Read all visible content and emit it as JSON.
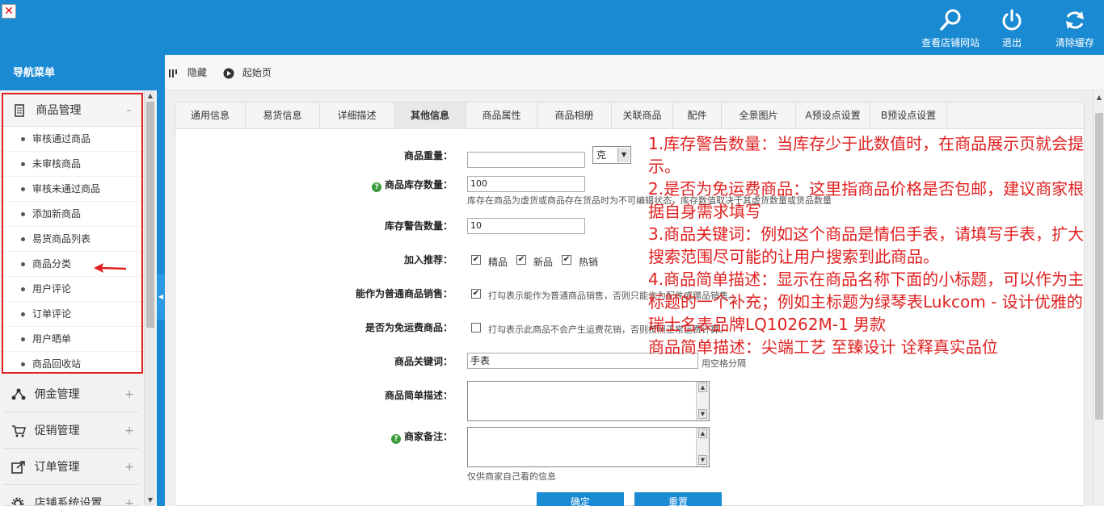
{
  "header": {
    "view_shop_label": "查看店铺网站",
    "logout_label": "退出",
    "clear_cache_label": "清除缓存"
  },
  "sidebar": {
    "title": "导航菜单",
    "active_group": {
      "label": "商品管理",
      "toggle": "–",
      "items": [
        "审核通过商品",
        "未审核商品",
        "审核未通过商品",
        "添加新商品",
        "易货商品列表",
        "商品分类",
        "用户评论",
        "订单评论",
        "用户晒单",
        "商品回收站"
      ]
    },
    "groups": [
      {
        "label": "佣金管理",
        "toggle": "+"
      },
      {
        "label": "促销管理",
        "toggle": "+"
      },
      {
        "label": "订单管理",
        "toggle": "+"
      },
      {
        "label": "店铺系统设置",
        "toggle": "+"
      }
    ]
  },
  "toolbar": {
    "hide_label": "隐藏",
    "home_label": "起始页"
  },
  "tabs": [
    "通用信息",
    "易货信息",
    "详细描述",
    "其他信息",
    "商品属性",
    "商品相册",
    "关联商品",
    "配件",
    "全景图片",
    "A预设点设置",
    "B预设点设置"
  ],
  "active_tab": "其他信息",
  "form": {
    "weight_label": "商品重量：",
    "weight_value": "",
    "weight_unit": "克",
    "stock_label": "商品库存数量：",
    "stock_value": "100",
    "stock_hint": "库存在商品为虚货或商品存在货品时为不可编辑状态，库存数值取决于其虚货数量或货品数量",
    "warn_label": "库存警告数量：",
    "warn_value": "10",
    "recommend_label": "加入推荐：",
    "recommend_options": [
      {
        "label": "精品",
        "checked": true
      },
      {
        "label": "新品",
        "checked": true
      },
      {
        "label": "热销",
        "checked": true
      }
    ],
    "normal_sale_label": "能作为普通商品销售：",
    "normal_sale_checked": true,
    "normal_sale_hint": "打勾表示能作为普通商品销售，否则只能作为配件或赠品销售。",
    "free_ship_label": "是否为免运费商品：",
    "free_ship_checked": false,
    "free_ship_hint": "打勾表示此商品不会产生运费花销，否则按照正常运费计算。",
    "keywords_label": "商品关键词：",
    "keywords_value": "手表",
    "keywords_hint": "用空格分隔",
    "brief_label": "商品简单描述：",
    "note_label": "商家备注：",
    "note_hint": "仅供商家自己看的信息",
    "confirm_label": "确定",
    "reset_label": "重置"
  },
  "annotation": [
    "1.库存警告数量：当库存少于此数值时，在商品展示页就会提示。",
    "2.是否为免运费商品：这里指商品价格是否包邮，建议商家根据自身需求填写",
    "3.商品关键词：例如这个商品是情侣手表，请填写手表，扩大搜索范围尽可能的让用户搜索到此商品。",
    "4.商品简单描述：显示在商品名称下面的小标题，可以作为主标题的一个补充；例如主标题为绿琴表Lukcom - 设计优雅的瑞士名表品牌LQ10262M-1 男款",
    "商品简单描述：尖端工艺 至臻设计 诠释真实品位"
  ],
  "colors": {
    "primary": "#1a8ad3",
    "annotation": "#e02020"
  }
}
